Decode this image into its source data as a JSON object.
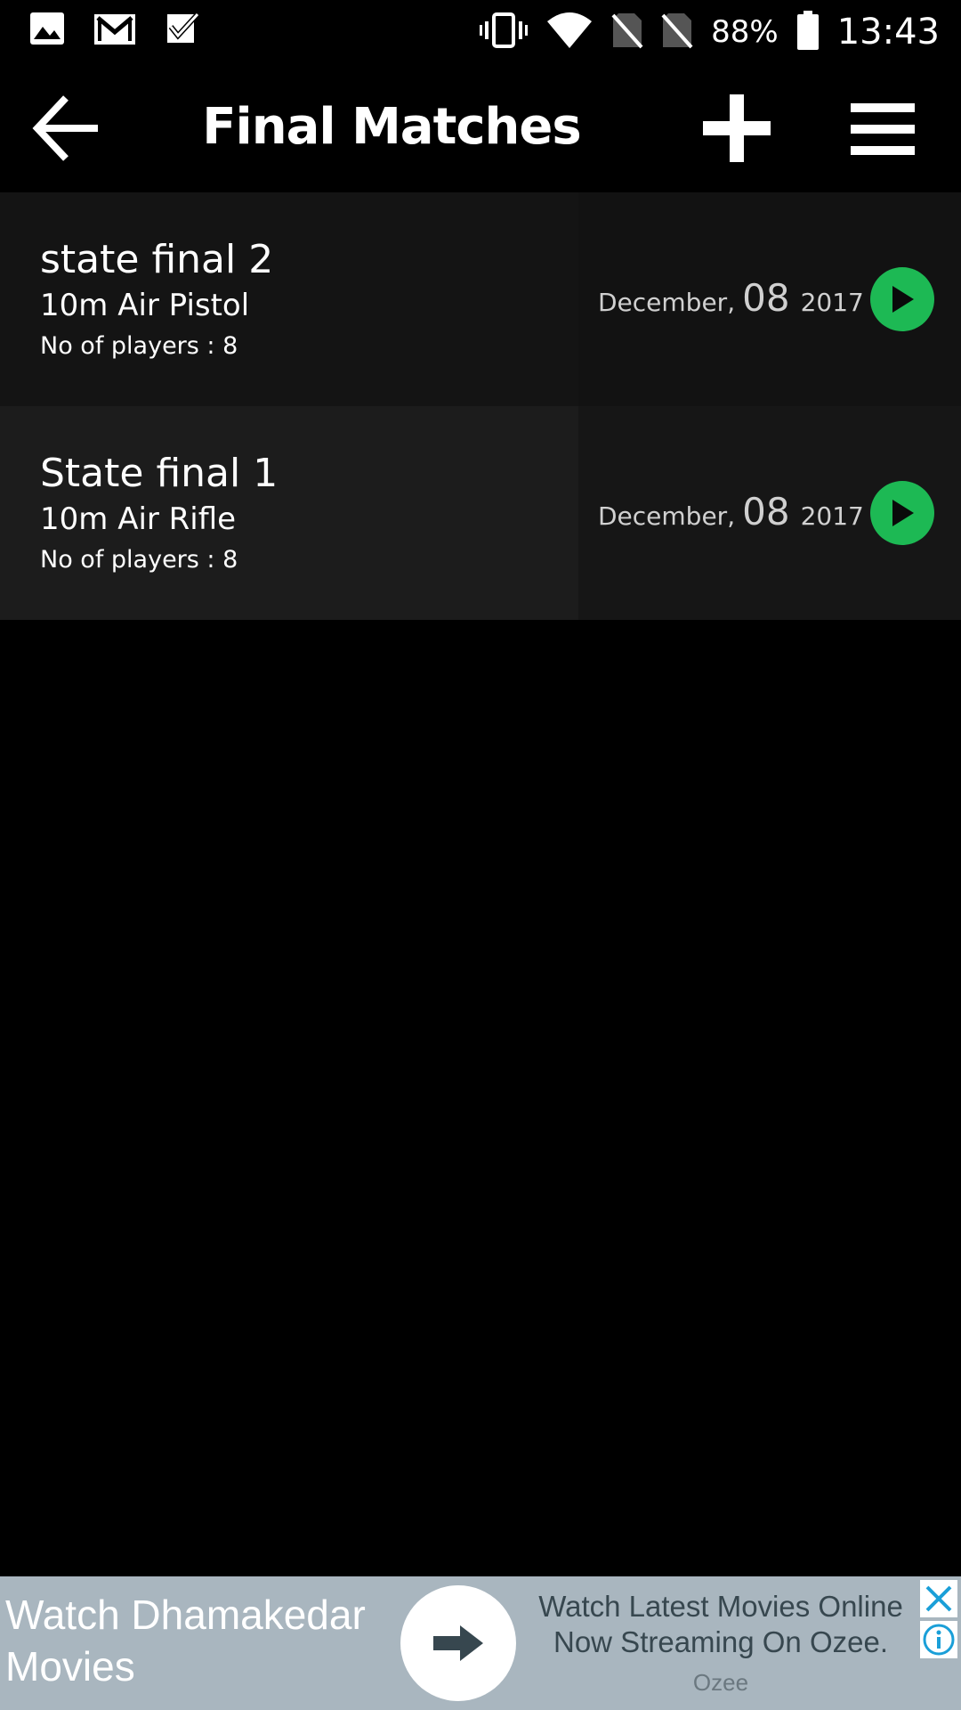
{
  "status_bar": {
    "left_icons": [
      "image-icon",
      "gmail-icon",
      "tasks-check-icon"
    ],
    "right_icons": [
      "vibrate-icon",
      "wifi-icon",
      "no-sim-icon",
      "no-sim-icon",
      "battery-icon"
    ],
    "battery": "88%",
    "time": "13:43"
  },
  "toolbar": {
    "title": "Final Matches",
    "back_icon": "arrow-left-icon",
    "add_icon": "plus-icon",
    "menu_icon": "hamburger-menu-icon"
  },
  "matches": [
    {
      "name": "state final 2",
      "event": "10m Air Pistol",
      "players": "No of players : 8",
      "month": "December,",
      "day": "08",
      "year": "2017",
      "action_icon": "play-icon"
    },
    {
      "name": "State final 1",
      "event": "10m Air Rifle",
      "players": "No of players : 8",
      "month": "December,",
      "day": "08",
      "year": "2017",
      "action_icon": "play-icon"
    }
  ],
  "ad": {
    "headline": "Watch Dhamakedar Movies",
    "body": "Watch Latest Movies Online Now Streaming On Ozee.",
    "brand": "Ozee",
    "cta_icon": "arrow-right-icon",
    "close_icon": "close-icon",
    "info_icon": "info-icon"
  },
  "colors": {
    "background": "#000000",
    "row_a": "#141414",
    "row_b": "#1c1c1c",
    "play_green": "#1db954",
    "ad_background": "#a9b6bf",
    "ad_accent": "#1a9fd8"
  }
}
